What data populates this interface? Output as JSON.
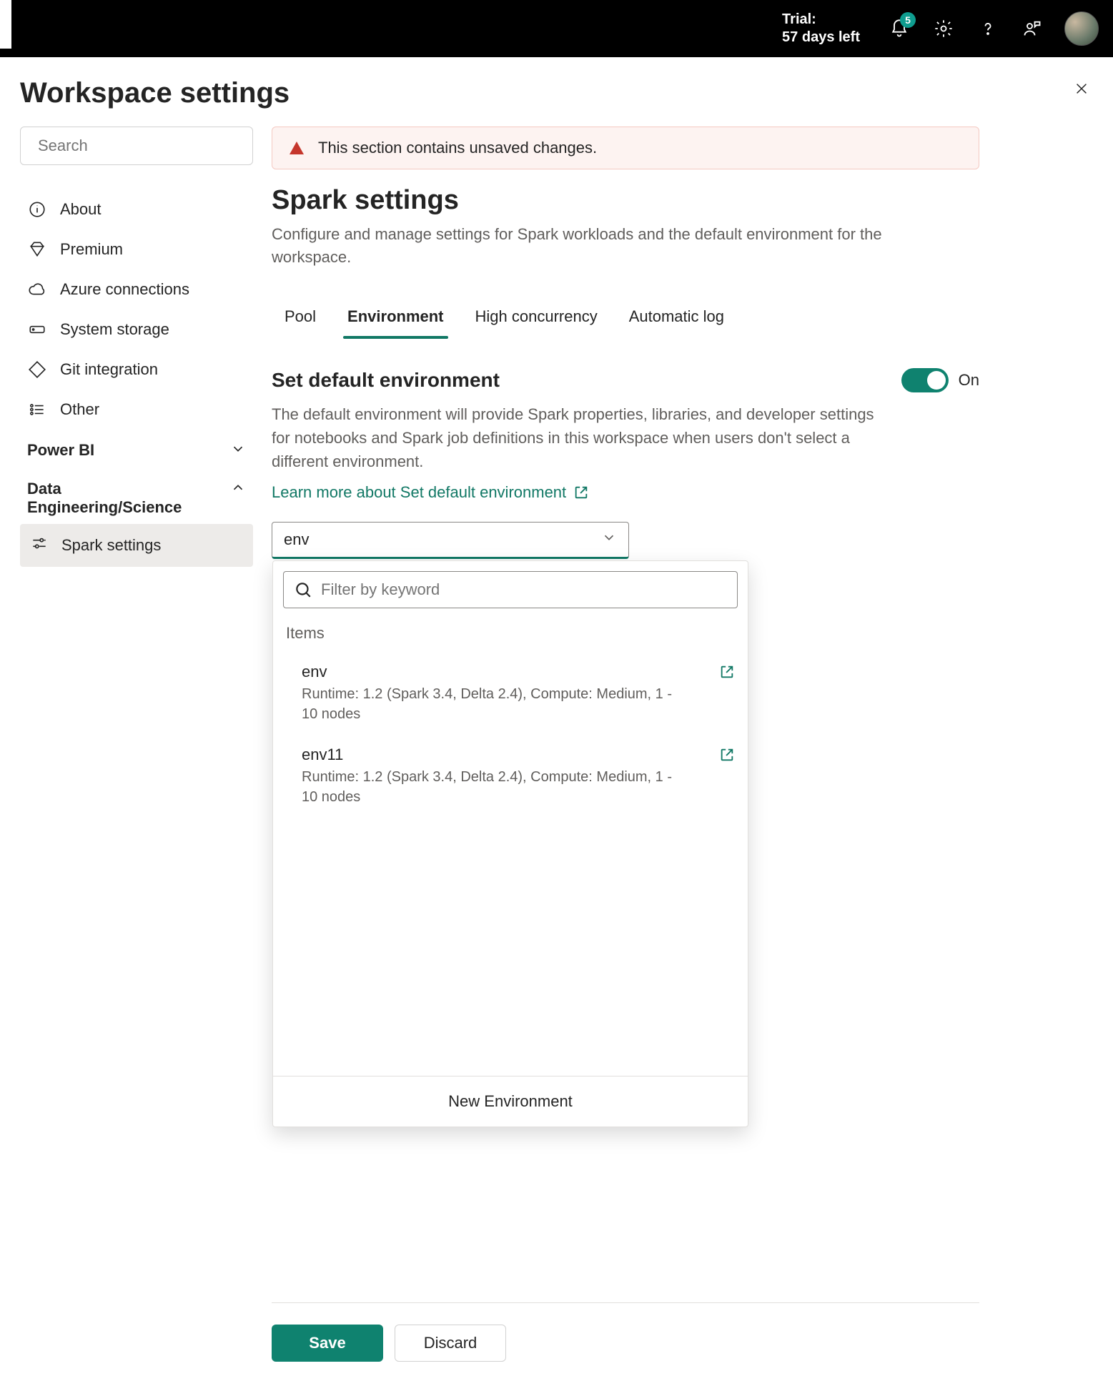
{
  "topbar": {
    "trial_label": "Trial:",
    "trial_days": "57 days left",
    "notification_count": "5"
  },
  "panel": {
    "title": "Workspace settings"
  },
  "sidebar": {
    "search_placeholder": "Search",
    "items": {
      "about": "About",
      "premium": "Premium",
      "azure": "Azure connections",
      "storage": "System storage",
      "git": "Git integration",
      "other": "Other"
    },
    "sections": {
      "powerbi": "Power BI",
      "data": "Data Engineering/Science"
    },
    "subitems": {
      "spark": "Spark settings"
    }
  },
  "alert": {
    "text": "This section contains unsaved changes."
  },
  "page": {
    "heading": "Spark settings",
    "description": "Configure and manage settings for Spark workloads and the default environment for the workspace."
  },
  "tabs": {
    "pool": "Pool",
    "environment": "Environment",
    "high_concurrency": "High concurrency",
    "automatic_log": "Automatic log"
  },
  "env_section": {
    "title": "Set default environment",
    "toggle_state": "On",
    "description": "The default environment will provide Spark properties, libraries, and developer settings for notebooks and Spark job definitions in this workspace when users don't select a different environment.",
    "learn_more": "Learn more about Set default environment"
  },
  "combo": {
    "value": "env"
  },
  "dropdown": {
    "filter_placeholder": "Filter by keyword",
    "items_label": "Items",
    "items": [
      {
        "name": "env",
        "meta": "Runtime: 1.2 (Spark 3.4, Delta 2.4), Compute: Medium, 1 - 10 nodes"
      },
      {
        "name": "env11",
        "meta": "Runtime: 1.2 (Spark 3.4, Delta 2.4), Compute: Medium, 1 - 10 nodes"
      }
    ],
    "new_env": "New Environment"
  },
  "buttons": {
    "save": "Save",
    "discard": "Discard"
  }
}
